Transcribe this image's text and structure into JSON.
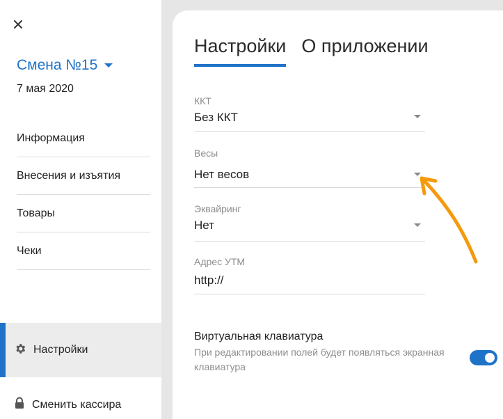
{
  "sidebar": {
    "shift_title": "Смена №15",
    "date": "7 мая 2020",
    "menu": [
      {
        "label": "Информация"
      },
      {
        "label": "Внесения и изъятия"
      },
      {
        "label": "Товары"
      },
      {
        "label": "Чеки"
      }
    ],
    "settings_label": "Настройки",
    "change_cashier_label": "Сменить кассира"
  },
  "tabs": [
    {
      "label": "Настройки",
      "active": true
    },
    {
      "label": "О приложении",
      "active": false
    }
  ],
  "fields": {
    "kkt": {
      "label": "ККТ",
      "value": "Без ККТ"
    },
    "scales": {
      "label": "Весы",
      "value": "Нет весов"
    },
    "acquiring": {
      "label": "Эквайринг",
      "value": "Нет"
    },
    "utm": {
      "label": "Адрес УТМ",
      "value": "http://"
    }
  },
  "virtual_keyboard": {
    "title": "Виртуальная клавиатура",
    "description": "При редактировании полей будет появляться экранная клавиатура",
    "enabled": true
  },
  "colors": {
    "accent": "#1e73c9",
    "annotation_arrow": "#f59a0c"
  },
  "icons": {
    "close": "close-icon",
    "settings": "gear-icon",
    "lock": "lock-icon",
    "dropdown": "chevron-down-icon"
  }
}
